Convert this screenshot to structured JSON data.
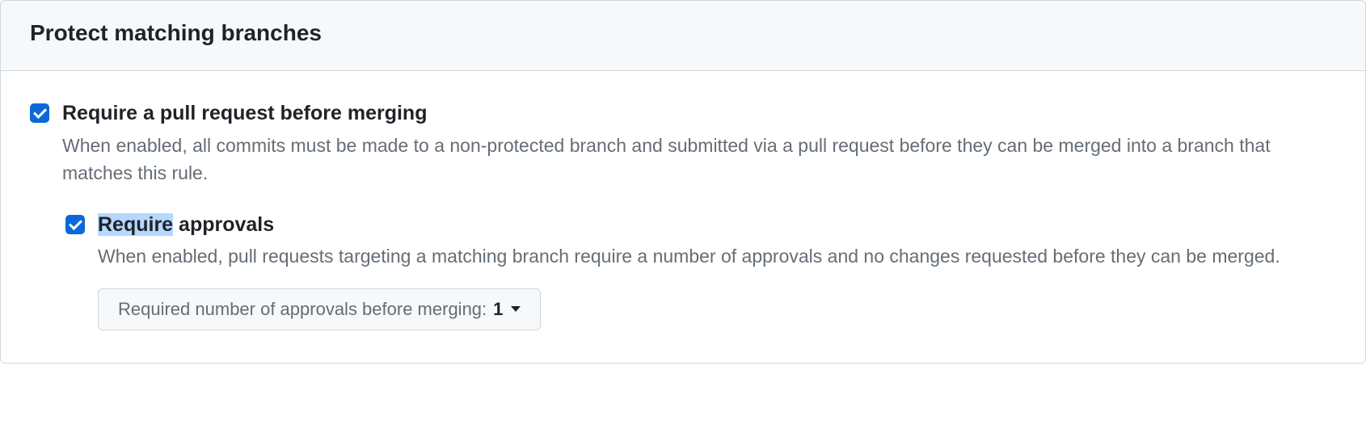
{
  "panel": {
    "title": "Protect matching branches"
  },
  "settings": {
    "requirePR": {
      "title": "Require a pull request before merging",
      "desc": "When enabled, all commits must be made to a non-protected branch and submitted via a pull request before they can be merged into a branch that matches this rule.",
      "checked": true
    },
    "requireApprovals": {
      "titleHighlighted": "Require",
      "titleRest": " approvals",
      "desc": "When enabled, pull requests targeting a matching branch require a number of approvals and no changes requested before they can be merged.",
      "checked": true,
      "dropdown": {
        "label": "Required number of approvals before merging: ",
        "value": "1"
      }
    }
  }
}
